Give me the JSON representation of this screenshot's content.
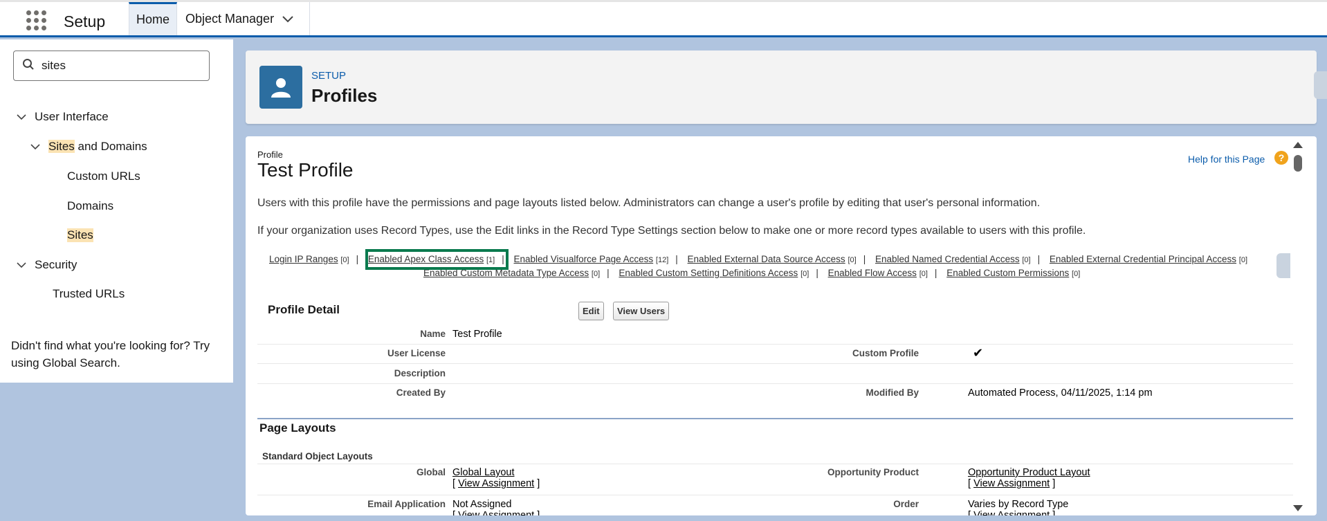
{
  "app": {
    "name": "Setup"
  },
  "tabs": {
    "home": "Home",
    "object_manager": "Object Manager"
  },
  "sidebar": {
    "search_value": "sites",
    "tree": {
      "user_interface": "User Interface",
      "sites_and_domains_hl": "Sites",
      "sites_and_domains_rest": " and Domains",
      "custom_urls": "Custom URLs",
      "domains": "Domains",
      "sites": "Sites",
      "security": "Security",
      "trusted_urls": "Trusted URLs"
    },
    "help_text": "Didn't find what you're looking for? Try using Global Search."
  },
  "header": {
    "eyebrow": "SETUP",
    "title": "Profiles"
  },
  "profile": {
    "type_label": "Profile",
    "name": "Test Profile",
    "help_link": "Help for this Page",
    "desc1": "Users with this profile have the permissions and page layouts listed below. Administrators can change a user's profile by editing that user's personal information.",
    "desc2": "If your organization uses Record Types, use the Edit links in the Record Type Settings section below to make one or more record types available to users with this profile."
  },
  "related_links": [
    {
      "label": "Login IP Ranges",
      "count": "[0]"
    },
    {
      "label": "Enabled Apex Class Access",
      "count": "[1]"
    },
    {
      "label": "Enabled Visualforce Page Access",
      "count": "[12]"
    },
    {
      "label": "Enabled External Data Source Access",
      "count": "[0]"
    },
    {
      "label": "Enabled Named Credential Access",
      "count": "[0]"
    },
    {
      "label": "Enabled External Credential Principal Access",
      "count": "[0]"
    },
    {
      "label": "Enabled Custom Metadata Type Access",
      "count": "[0]"
    },
    {
      "label": "Enabled Custom Setting Definitions Access",
      "count": "[0]"
    },
    {
      "label": "Enabled Flow Access",
      "count": "[0]"
    },
    {
      "label": "Enabled Custom Permissions",
      "count": "[0]"
    }
  ],
  "profile_detail": {
    "title": "Profile Detail",
    "edit_button": "Edit",
    "view_users_button": "View Users",
    "name_label": "Name",
    "name_value": "Test Profile",
    "user_license_label": "User License",
    "custom_profile_label": "Custom Profile",
    "custom_profile_check": "✔",
    "description_label": "Description",
    "created_by_label": "Created By",
    "modified_by_label": "Modified By",
    "modified_by_value": "Automated Process, 04/11/2025, 1:14 pm"
  },
  "page_layouts": {
    "title": "Page Layouts",
    "subtitle": "Standard Object Layouts",
    "global_label": "Global",
    "global_value": "Global Layout",
    "opp_product_label": "Opportunity Product",
    "opp_product_value": "Opportunity Product Layout",
    "view_assignment": "View Assignment",
    "bracket_open": "[ ",
    "bracket_close": " ]",
    "email_app_label": "Email Application",
    "email_app_value": "Not Assigned",
    "order_label": "Order",
    "order_value": "Varies by Record Type"
  }
}
